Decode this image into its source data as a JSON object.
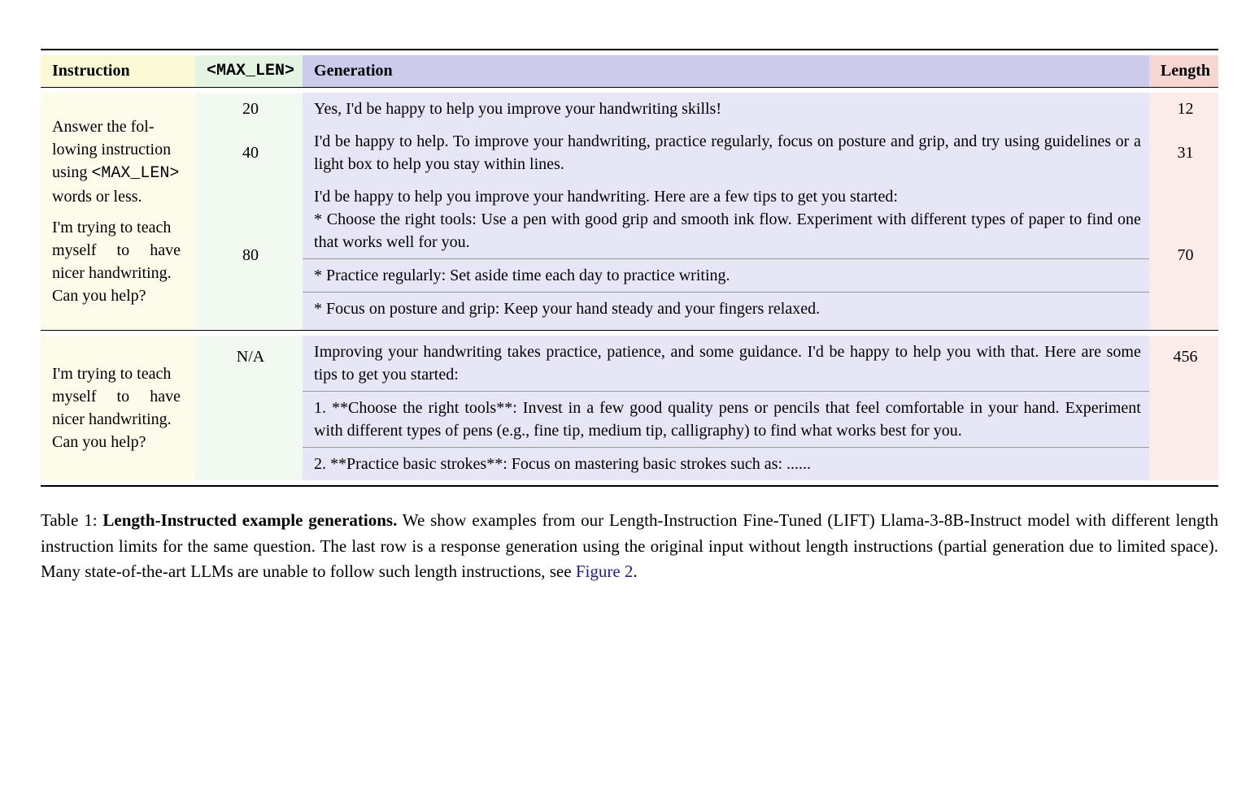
{
  "headers": {
    "instruction": "Instruction",
    "maxlen": "<MAX_LEN>",
    "generation": "Generation",
    "length": "Length"
  },
  "group1": {
    "instruction_line1": "Answer the fol-",
    "instruction_line2": "lowing instruction",
    "instruction_line3_a": "using ",
    "instruction_line3_b": "<MAX_LEN>",
    "instruction_line4": "words or less.",
    "instruction_line5": "I'm trying to teach",
    "instruction_line6": "myself to have",
    "instruction_line7": "nicer handwriting.",
    "instruction_line8": "Can you help?",
    "rows": [
      {
        "maxlen": "20",
        "generation": "Yes, I'd be happy to help you improve your handwriting skills!",
        "length": "12"
      },
      {
        "maxlen": "40",
        "generation": "I'd be happy to help. To improve your handwriting, practice regularly, focus on posture and grip, and try using guidelines or a light box to help you stay within lines.",
        "length": "31"
      },
      {
        "maxlen": "80",
        "gen_intro": "I'd be happy to help you improve your handwriting.  Here are a few tips to get you started:",
        "gen_b1": " * Choose the right tools: Use a pen with good grip and smooth ink flow. Experiment with different types of paper to find one that works well for you.",
        "gen_b2": " * Practice regularly: Set aside time each day to practice writing.",
        "gen_b3": " * Focus on posture and grip: Keep your hand steady and your fingers relaxed.",
        "length": "70"
      }
    ]
  },
  "group2": {
    "instruction_line1": "I'm trying to teach",
    "instruction_line2": "myself to have",
    "instruction_line3": "nicer handwriting.",
    "instruction_line4": "Can you help?",
    "maxlen": "N/A",
    "gen_p1": "Improving your handwriting takes practice, patience, and some guidance. I'd be happy to help you with that. Here are some tips to get you started:",
    "gen_p2": "1. **Choose the right tools**: Invest in a few good quality pens or pencils that feel comfortable in your hand. Experiment with different types of pens (e.g., fine tip, medium tip, calligraphy) to find what works best for you.",
    "gen_p3": "2. **Practice basic strokes**: Focus on mastering basic strokes such as: ......",
    "length": "456"
  },
  "caption": {
    "label": "Table 1: ",
    "title": "Length-Instructed example generations.",
    "body": " We show examples from our Length-Instruction Fine-Tuned (LIFT) Llama-3-8B-Instruct model with different length instruction limits for the same question. The last row is a response generation using the original input without length instructions (partial generation due to limited space). Many state-of-the-art LLMs are unable to follow such length instructions, see ",
    "link": "Figure 2",
    "tail": "."
  }
}
